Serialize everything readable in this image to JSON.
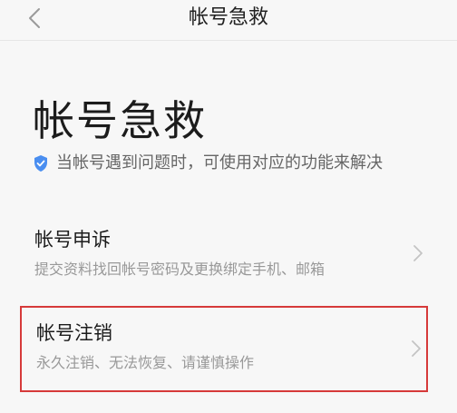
{
  "nav": {
    "title": "帐号急救"
  },
  "hero": {
    "title": "帐号急救",
    "hint": "当帐号遇到问题时，可使用对应的功能来解决"
  },
  "items": [
    {
      "label": "帐号申诉",
      "desc": "提交资料找回帐号密码及更换绑定手机、邮箱"
    },
    {
      "label": "帐号注销",
      "desc": "永久注销、无法恢复、请谨慎操作"
    }
  ],
  "colors": {
    "background": "#f7f7f7",
    "shield": "#4a8ef0",
    "highlight": "#d63a3a",
    "muted_text": "#999999"
  },
  "icons": {
    "back": "chevron-left-icon",
    "shield": "shield-check-icon",
    "item_arrow": "chevron-right-icon"
  }
}
